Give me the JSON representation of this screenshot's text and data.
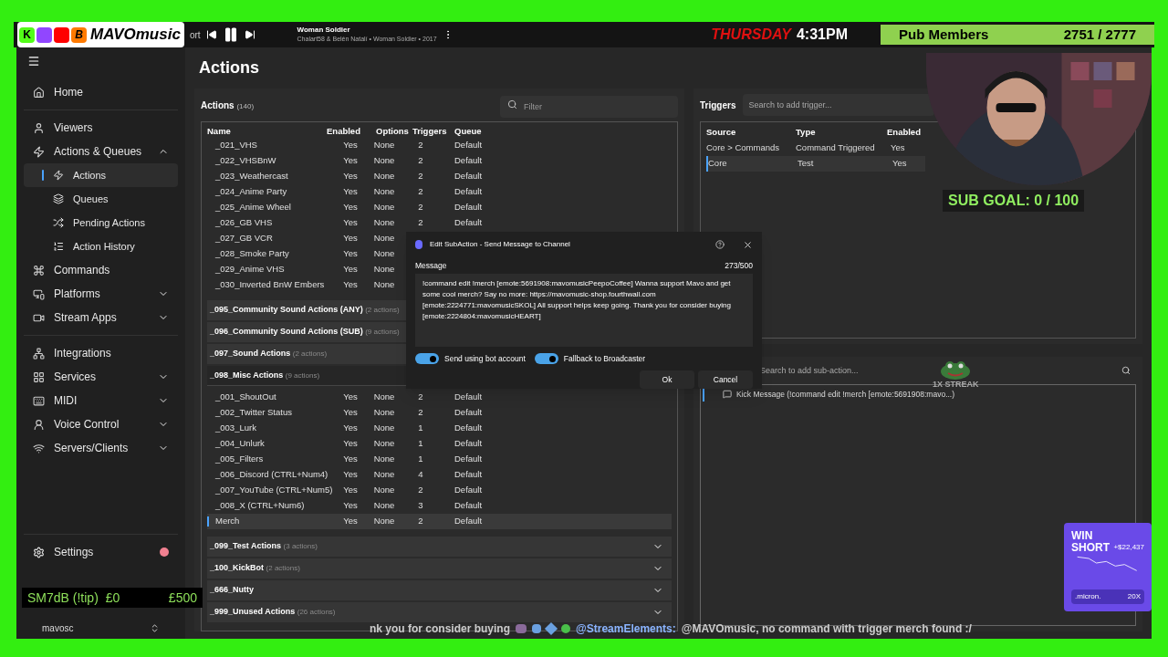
{
  "overlay_bar": {
    "brand": "MAVOmusic",
    "logo_letters": [
      "K",
      "B"
    ],
    "cut_text": "ort",
    "song": {
      "title": "Woman Soldier",
      "subtitle": "Chalart58 & Belén Natalí • Woman Soldier • 2017"
    },
    "day": "THURSDAY",
    "time": "4:31PM",
    "members": {
      "label": "Pub Members",
      "count": "2751 / 2777"
    }
  },
  "sidebar": {
    "sections": [
      {
        "items": [
          {
            "label": "Home",
            "selected": false
          }
        ]
      },
      {
        "items": [
          {
            "label": "Viewers",
            "selected": false
          },
          {
            "label": "Actions & Queues",
            "selected": false,
            "expanded": true,
            "children": [
              {
                "label": "Actions",
                "selected": true
              },
              {
                "label": "Queues",
                "selected": false
              },
              {
                "label": "Pending Actions",
                "selected": false
              },
              {
                "label": "Action History",
                "selected": false
              }
            ]
          },
          {
            "label": "Commands",
            "selected": false
          },
          {
            "label": "Platforms",
            "selected": false,
            "expanded": false
          },
          {
            "label": "Stream Apps",
            "selected": false,
            "expanded": false
          }
        ]
      },
      {
        "items": [
          {
            "label": "Integrations",
            "selected": false
          },
          {
            "label": "Services",
            "selected": false,
            "expanded": false
          },
          {
            "label": "MIDI",
            "selected": false,
            "expanded": false
          },
          {
            "label": "Voice Control",
            "selected": false,
            "expanded": false
          },
          {
            "label": "Servers/Clients",
            "selected": false,
            "expanded": false
          }
        ]
      }
    ],
    "settings": {
      "label": "Settings",
      "notification": true
    },
    "profile": "mavosc"
  },
  "page_title": "Actions",
  "actions_panel": {
    "title": "Actions",
    "count": "(140)",
    "filter_placeholder": "Filter",
    "columns": [
      "Name",
      "Enabled",
      "Options",
      "Triggers",
      "Queue"
    ],
    "groups": [
      {
        "rows": [
          {
            "name": "_021_VHS",
            "enabled": "Yes",
            "options": "None",
            "triggers": "2",
            "queue": "Default",
            "selected": false
          },
          {
            "name": "_022_VHSBnW",
            "enabled": "Yes",
            "options": "None",
            "triggers": "2",
            "queue": "Default",
            "selected": false
          },
          {
            "name": "_023_Weathercast",
            "enabled": "Yes",
            "options": "None",
            "triggers": "2",
            "queue": "Default",
            "selected": false
          },
          {
            "name": "_024_Anime Party",
            "enabled": "Yes",
            "options": "None",
            "triggers": "2",
            "queue": "Default",
            "selected": false
          },
          {
            "name": "_025_Anime Wheel",
            "enabled": "Yes",
            "options": "None",
            "triggers": "2",
            "queue": "Default",
            "selected": false
          },
          {
            "name": "_026_GB VHS",
            "enabled": "Yes",
            "options": "None",
            "triggers": "2",
            "queue": "Default",
            "selected": false
          },
          {
            "name": "_027_GB VCR",
            "enabled": "Yes",
            "options": "None",
            "selected": false
          },
          {
            "name": "_028_Smoke Party",
            "enabled": "Yes",
            "options": "None",
            "selected": false
          },
          {
            "name": "_029_Anime VHS",
            "enabled": "Yes",
            "options": "None",
            "selected": false
          },
          {
            "name": "_030_Inverted BnW Embers",
            "enabled": "Yes",
            "options": "None",
            "selected": false
          }
        ]
      },
      {
        "name": "_095_Community Sound Actions (ANY)",
        "count": "(2 actions)"
      },
      {
        "name": "_096_Community Sound Actions (SUB)",
        "count": "(9 actions)"
      },
      {
        "name": "_097_Sound Actions",
        "count": "(2 actions)"
      },
      {
        "name": "_098_Misc Actions",
        "count": "(9 actions)",
        "expanded": true,
        "rows": [
          {
            "name": "_001_ShoutOut",
            "enabled": "Yes",
            "options": "None",
            "triggers": "2",
            "queue": "Default",
            "selected": false
          },
          {
            "name": "_002_Twitter Status",
            "enabled": "Yes",
            "options": "None",
            "triggers": "2",
            "queue": "Default",
            "selected": false
          },
          {
            "name": "_003_Lurk",
            "enabled": "Yes",
            "options": "None",
            "triggers": "1",
            "queue": "Default",
            "selected": false
          },
          {
            "name": "_004_Unlurk",
            "enabled": "Yes",
            "options": "None",
            "triggers": "1",
            "queue": "Default",
            "selected": false
          },
          {
            "name": "_005_Filters",
            "enabled": "Yes",
            "options": "None",
            "triggers": "1",
            "queue": "Default",
            "selected": false
          },
          {
            "name": "_006_Discord (CTRL+Num4)",
            "enabled": "Yes",
            "options": "None",
            "triggers": "4",
            "queue": "Default",
            "selected": false
          },
          {
            "name": "_007_YouTube (CTRL+Num5)",
            "enabled": "Yes",
            "options": "None",
            "triggers": "2",
            "queue": "Default",
            "selected": false
          },
          {
            "name": "_008_X (CTRL+Num6)",
            "enabled": "Yes",
            "options": "None",
            "triggers": "3",
            "queue": "Default",
            "selected": false
          },
          {
            "name": "Merch",
            "enabled": "Yes",
            "options": "None",
            "triggers": "2",
            "queue": "Default",
            "selected": true
          }
        ]
      },
      {
        "name": "_099_Test Actions",
        "count": "(3 actions)",
        "expanded": false
      },
      {
        "name": "_100_KickBot",
        "count": "(2 actions)",
        "expanded": false
      },
      {
        "name": "_666_Nutty",
        "expanded": false
      },
      {
        "name": "_999_Unused Actions",
        "count": "(26 actions)",
        "expanded": false
      }
    ]
  },
  "triggers_panel": {
    "title": "Triggers",
    "search_placeholder": "Search to add trigger...",
    "columns": [
      "Source",
      "Type",
      "Enabled"
    ],
    "rows": [
      {
        "source": "Core > Commands",
        "type": "Command Triggered",
        "enabled": "Yes",
        "selected": false
      },
      {
        "source": "Core",
        "type": "Test",
        "enabled": "Yes",
        "selected": true
      }
    ]
  },
  "subactions_panel": {
    "search_placeholder": "Search to add sub-action...",
    "items": [
      {
        "label": "Kick Message (!command edit !merch [emote:5691908:mavo...)",
        "selected": true
      }
    ]
  },
  "dialog": {
    "title": "Edit SubAction - Send Message to Channel",
    "message_label": "Message",
    "counter": "273/500",
    "message": "!command edit !merch [emote:5691908:mavomusicPeepoCoffee] Wanna support Mavo and get some cool merch? Say no more: https://mavomusic-shop.fourthwall.com [emote:2224771:mavomusicSKOL] All support helps keep going. Thank you for consider buying [emote:2224804:mavomusicHEART]",
    "toggles": [
      {
        "label": "Send using bot account",
        "on": true
      },
      {
        "label": "Fallback to Broadcaster",
        "on": true
      }
    ],
    "buttons": [
      "Ok",
      "Cancel"
    ]
  },
  "sub_goal": "SUB GOAL: 0 / 100",
  "streak": "1X STREAK",
  "tip_bar": {
    "label": "SM7dB (!tip)",
    "current": "£0",
    "goal": "£500"
  },
  "ad_card": {
    "line1": "WIN",
    "line2": "SHORT",
    "amount": "+$22,437",
    "brand": ".micron.",
    "multiplier": "20X"
  },
  "chat_ticker": {
    "lead": "nk you for consider buying",
    "author": "@StreamElements:",
    "text": "@MAVOmusic, no command with trigger merch found :/"
  }
}
